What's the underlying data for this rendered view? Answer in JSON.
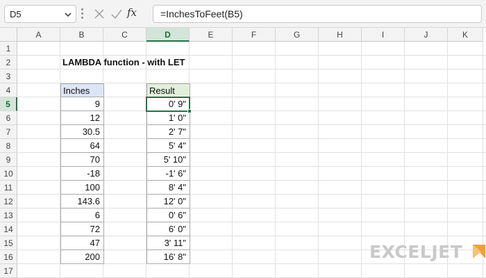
{
  "formula_bar": {
    "name_box": "D5",
    "formula": "=InchesToFeet(B5)",
    "fx_label": "fx",
    "icons": [
      "chevron-down-icon",
      "cancel-x-icon",
      "enter-check-icon",
      "function-fx-icon"
    ]
  },
  "columns": [
    "A",
    "B",
    "C",
    "D",
    "E",
    "F",
    "G",
    "H",
    "I",
    "J",
    "K"
  ],
  "selected_column": "D",
  "rows": [
    "1",
    "2",
    "3",
    "4",
    "5",
    "6",
    "7",
    "8",
    "9",
    "10",
    "11",
    "12",
    "13",
    "14",
    "15",
    "16",
    "17"
  ],
  "selected_row": "5",
  "sheet": {
    "title": "LAMBDA function - with LET",
    "inches_header": "Inches",
    "result_header": "Result",
    "inches": [
      "9",
      "12",
      "30.5",
      "64",
      "70",
      "-18",
      "100",
      "143.6",
      "6",
      "72",
      "47",
      "200"
    ],
    "results": [
      "0' 9\"",
      "1' 0\"",
      "2' 7\"",
      "5' 4\"",
      "5' 10\"",
      "-1' 6\"",
      "8' 4\"",
      "12' 0\"",
      "0' 6\"",
      "6' 0\"",
      "3' 11\"",
      "16' 8\""
    ]
  },
  "colors": {
    "inches_header_bg": "#dce6f7",
    "result_header_bg": "#e2efda",
    "accent": "#217346",
    "logo_orange": "#f0a030"
  },
  "logo": {
    "text": "EXCELJET"
  }
}
